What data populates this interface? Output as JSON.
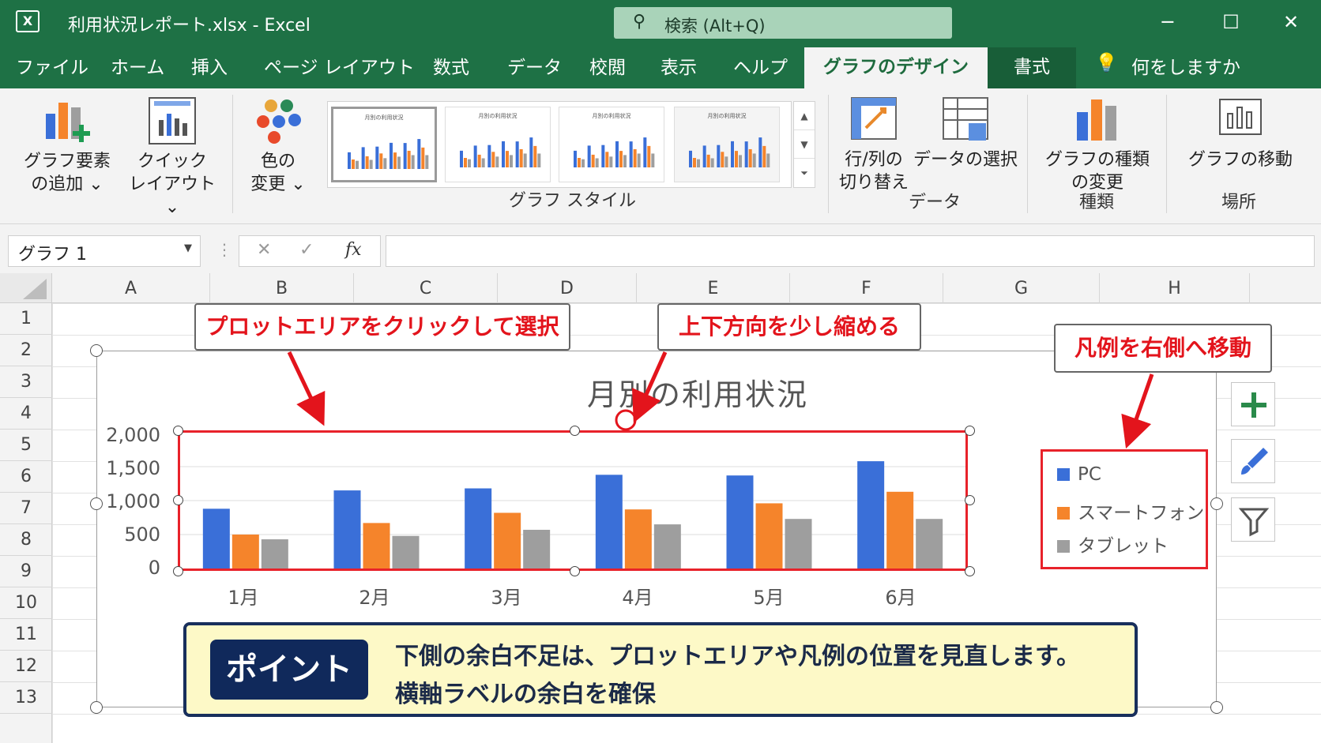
{
  "window": {
    "app_icon": "excel-icon",
    "title": "利用状況レポート.xlsx  -  Excel",
    "search_placeholder": "検索 (Alt+Q)",
    "controls": [
      "minimize",
      "maximize",
      "close"
    ]
  },
  "tabs": {
    "items": [
      "ファイル",
      "ホーム",
      "挿入",
      "ページ レイアウト",
      "数式",
      "データ",
      "校閲",
      "表示",
      "ヘルプ"
    ],
    "active": "グラフのデザイン",
    "format": "書式",
    "tell_me": "何をしますか"
  },
  "ribbon": {
    "add_element": [
      "グラフ要素",
      "の追加 ⌄"
    ],
    "quick_layout": [
      "クイック",
      "レイアウト ⌄"
    ],
    "change_colors": [
      "色の",
      "変更 ⌄"
    ],
    "chart_styles_label": "グラフ スタイル",
    "style_thumb_title": "月別の利用状況",
    "switch_row_col": [
      "行/列の",
      "切り替え"
    ],
    "select_data": "データの選択",
    "data_group_label": "データ",
    "change_type": [
      "グラフの種類",
      "の変更"
    ],
    "type_group_label": "種類",
    "move_chart": "グラフの移動",
    "location_group_label": "場所"
  },
  "formula_bar": {
    "name_box": "グラフ 1",
    "fx": "fx",
    "cancel": "✕",
    "enter": "✓",
    "value": ""
  },
  "sheet": {
    "columns": [
      "A",
      "B",
      "C",
      "D",
      "E",
      "F",
      "G",
      "H"
    ],
    "rows": [
      "1",
      "2",
      "3",
      "4",
      "5",
      "6",
      "7",
      "8",
      "9",
      "10",
      "11",
      "12",
      "13"
    ]
  },
  "chart_data": {
    "type": "bar",
    "title": "月別の利用状況",
    "categories": [
      "1月",
      "2月",
      "3月",
      "4月",
      "5月",
      "6月"
    ],
    "series": [
      {
        "name": "PC",
        "color": "#3a6fd8",
        "values": [
          880,
          1150,
          1180,
          1380,
          1370,
          1580
        ]
      },
      {
        "name": "スマートフォン",
        "color": "#f5842b",
        "values": [
          500,
          670,
          820,
          870,
          960,
          1130
        ]
      },
      {
        "name": "タブレット",
        "color": "#9e9e9e",
        "values": [
          430,
          480,
          570,
          650,
          730,
          730
        ]
      }
    ],
    "yticks": [
      "2,000",
      "1,500",
      "1,000",
      "500",
      "0"
    ],
    "ylim": [
      0,
      2000
    ],
    "grid": true,
    "legend_position": "right"
  },
  "callouts": {
    "plot_area": "プロットエリアをクリックして選択",
    "shrink": "上下方向を少し縮める",
    "legend": "凡例を右側へ移動"
  },
  "point": {
    "badge": "ポイント",
    "line1": "下側の余白不足は、プロットエリアや凡例の位置を見直します。",
    "line2": "横軸ラベルの余白を確保"
  },
  "chart_tools": [
    "plus-icon",
    "brush-icon",
    "filter-icon"
  ],
  "accent_colors": {
    "excel_green": "#1e7145",
    "callout_red": "#e3141c",
    "point_navy": "#10295b"
  }
}
